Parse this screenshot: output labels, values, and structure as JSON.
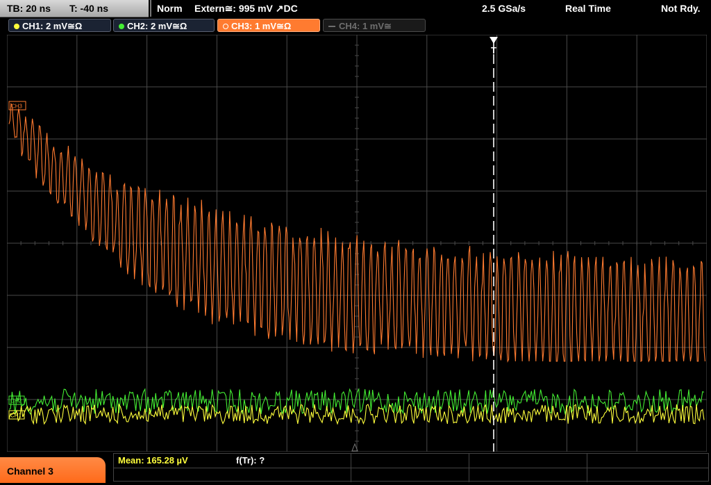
{
  "topbar": {
    "timebase": "TB: 20 ns",
    "trigger_time": "T: -40 ns",
    "mode": "Norm",
    "trigger_source": "Extern≅: 995 mV ↗DC",
    "sample_rate": "2.5 GSa/s",
    "acq_mode": "Real Time",
    "status": "Not Rdy."
  },
  "channels": [
    {
      "id": "ch1",
      "label": "CH1: 2 mV≅Ω",
      "color": "#ffff3c",
      "active": true
    },
    {
      "id": "ch2",
      "label": "CH2: 2 mV≅Ω",
      "color": "#44ee33",
      "active": true
    },
    {
      "id": "ch3",
      "label": "CH3: 1 mV≅Ω",
      "color": "#ff7b30",
      "active": true,
      "selected": true
    },
    {
      "id": "ch4",
      "label": "CH4: 1 mV≅",
      "color": "#6e6e6e",
      "active": false
    }
  ],
  "plot": {
    "trigger_marker": "T",
    "ch3_marker": "CH3",
    "ch2_marker": "CH2",
    "ch1_marker": "CH1"
  },
  "bottom": {
    "selected_channel": "Channel 3",
    "mean_label": "Mean: 165.28 µV",
    "freq_label": "f(Tr): ?"
  },
  "colors": {
    "grid": "#4a4a4a",
    "ch1": "#ffff3c",
    "ch2": "#44ee33",
    "ch3": "#ff7b30",
    "mean_text": "#ffff3c"
  }
}
